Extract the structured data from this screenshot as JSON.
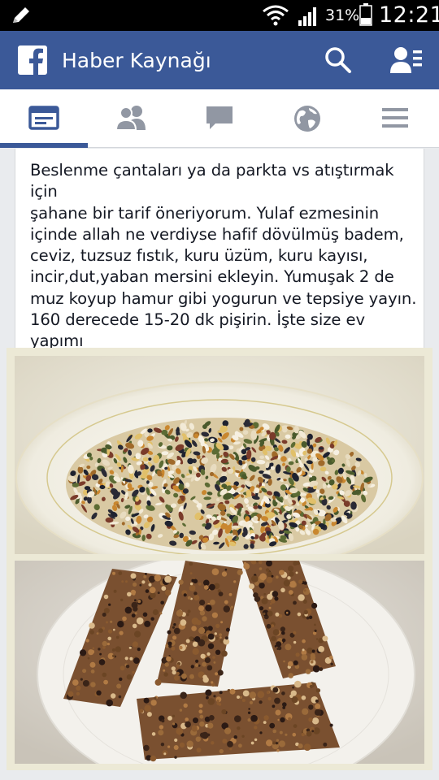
{
  "status_bar": {
    "battery_percent": "31%",
    "time": "12:21",
    "icons": [
      "edit-icon",
      "wifi-icon",
      "signal-icon",
      "battery-icon"
    ]
  },
  "app_bar": {
    "title": "Haber Kaynağı",
    "brand_color": "#3b5998",
    "icons": [
      "facebook-logo",
      "search-icon",
      "friend-requests-icon"
    ]
  },
  "tabs": [
    {
      "icon": "news-feed-icon",
      "active": true
    },
    {
      "icon": "friends-icon",
      "active": false
    },
    {
      "icon": "messages-icon",
      "active": false
    },
    {
      "icon": "globe-icon",
      "active": false
    },
    {
      "icon": "menu-icon",
      "active": false
    }
  ],
  "post": {
    "text": "Beslenme çantaları ya da parkta vs atıştırmak için\nşahane bir tarif öneriyorum. Yulaf ezmesinin\niçinde allah ne verdiyse hafif dövülmüş badem,\nceviz, tuzsuz fıstık, kuru üzüm, kuru kayısı,\nincir,dut,yaban mersini ekleyin. Yumuşak 2 de\nmuz koyup hamur gibi yogurun ve tepsiye yayın.\n160 derecede 15-20 dk pişirin. İşte size ev yapımı\ntahıl bar.",
    "photo": {
      "top_image": "plate of oats, pumpkin seeds and dried fruit mix",
      "bottom_image": "homemade granola bars on a white plate"
    }
  }
}
